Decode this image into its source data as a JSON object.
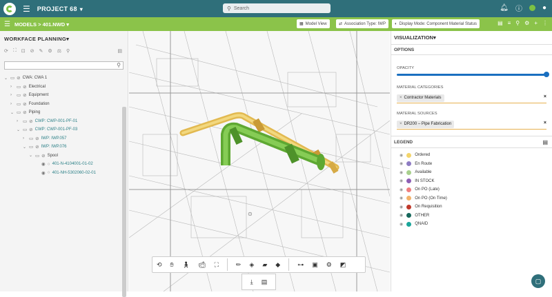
{
  "app": {
    "project_title": "PROJECT 68",
    "search_placeholder": "Search"
  },
  "subheader": {
    "breadcrumb_models": "MODELS",
    "breadcrumb_sep": ">",
    "breadcrumb_file": "401.NWD",
    "btn_model_view": "Model View",
    "btn_association": "Association Type: IWP",
    "btn_display_mode": "Display Mode: Component Material Status"
  },
  "left_panel": {
    "title": "WORKFACE PLANNING",
    "tree": [
      {
        "label": "CWA: CWA 1",
        "indent": 0,
        "twisty": "v",
        "link": false
      },
      {
        "label": "Electrical",
        "indent": 1,
        "twisty": ">",
        "link": false
      },
      {
        "label": "Equipment",
        "indent": 1,
        "twisty": ">",
        "link": false
      },
      {
        "label": "Foundation",
        "indent": 1,
        "twisty": ">",
        "link": false
      },
      {
        "label": "Piping",
        "indent": 1,
        "twisty": "v",
        "link": false
      },
      {
        "label": "CWP: CWP-001-PF-01",
        "indent": 2,
        "twisty": ">",
        "link": true
      },
      {
        "label": "CWP: CWP-001-PF-03",
        "indent": 2,
        "twisty": "v",
        "link": true
      },
      {
        "label": "IWP: IWP.057",
        "indent": 3,
        "twisty": ">",
        "link": true
      },
      {
        "label": "IWP: IWP.076",
        "indent": 3,
        "twisty": "v",
        "link": true
      },
      {
        "label": "Spool",
        "indent": 4,
        "twisty": "v",
        "link": false
      },
      {
        "label": "401-N-4104001-01-02",
        "indent": 5,
        "twisty": "",
        "link": true
      },
      {
        "label": "401-NH-5302060-02-01",
        "indent": 5,
        "twisty": "",
        "link": true
      }
    ]
  },
  "right_panel": {
    "title": "VISUALIZATION",
    "options_label": "OPTIONS",
    "opacity_label": "OPACITY",
    "opacity_value": 1.0,
    "material_categories_label": "MATERIAL CATEGORIES",
    "material_category_chip": "Contractor Materials",
    "material_sources_label": "MATERIAL SOURCES",
    "material_source_chip": "DR200 – Pipe Fabrication",
    "legend_label": "LEGEND",
    "legend": [
      {
        "label": "Ordered",
        "color": "#f3d56b"
      },
      {
        "label": "En Route",
        "color": "#8e7cc3"
      },
      {
        "label": "Available",
        "color": "#a8d08d"
      },
      {
        "label": "IN STOCK",
        "color": "#8e5fb5"
      },
      {
        "label": "On PO (Late)",
        "color": "#ef7f7f"
      },
      {
        "label": "On PO (On Time)",
        "color": "#f3b36b"
      },
      {
        "label": "On Requisition",
        "color": "#c0392b"
      },
      {
        "label": "OTHER",
        "color": "#16675b"
      },
      {
        "label": "QNAID",
        "color": "#1aa59a"
      }
    ]
  },
  "colors": {
    "topbar": "#2f6f7a",
    "subbar": "#8bc34a",
    "accent_blue": "#1a6fc0",
    "pipe_yellow": "#e9c46a",
    "pipe_green": "#7cc243"
  }
}
